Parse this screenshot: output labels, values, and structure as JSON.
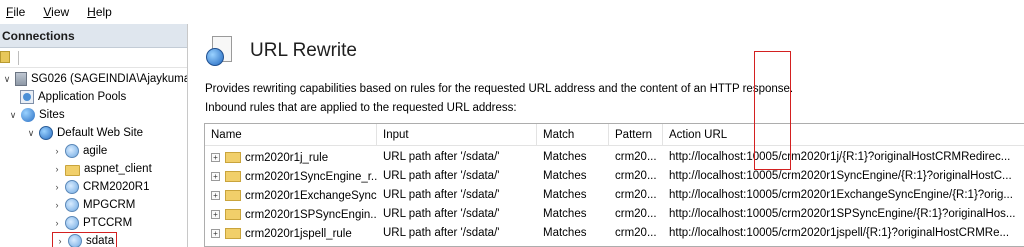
{
  "menu": [
    {
      "label": "File",
      "key": "F",
      "rest": "ile"
    },
    {
      "label": "View",
      "key": "V",
      "rest": "iew"
    },
    {
      "label": "Help",
      "key": "H",
      "rest": "elp"
    }
  ],
  "connections": {
    "title": "Connections",
    "tree": [
      {
        "label": "SG026 (SAGEINDIA\\Ajaykuma",
        "icon": "server-icon",
        "expander": "v"
      },
      {
        "label": "Application Pools",
        "icon": "app-pools-icon",
        "expander": ""
      },
      {
        "label": "Sites",
        "icon": "sites-icon",
        "expander": "v"
      },
      {
        "label": "Default Web Site",
        "icon": "globe-icon",
        "expander": "v"
      },
      {
        "label": "agile",
        "icon": "application-icon",
        "expander": ">"
      },
      {
        "label": "aspnet_client",
        "icon": "folder-icon",
        "expander": ">"
      },
      {
        "label": "CRM2020R1",
        "icon": "application-icon",
        "expander": ">"
      },
      {
        "label": "MPGCRM",
        "icon": "application-icon",
        "expander": ">"
      },
      {
        "label": "PTCCRM",
        "icon": "application-icon",
        "expander": ">"
      },
      {
        "label": "sdata",
        "icon": "application-icon",
        "expander": ">",
        "selected": true
      }
    ]
  },
  "page": {
    "title": "URL Rewrite",
    "description": "Provides rewriting capabilities based on rules for the requested URL address and the content of an HTTP response.",
    "inbound_caption": "Inbound rules that are applied to the requested URL address:"
  },
  "rules_table": {
    "columns": [
      "Name",
      "Input",
      "Match",
      "Pattern",
      "Action URL"
    ],
    "rows": [
      {
        "name": "crm2020r1j_rule",
        "input": "URL path after '/sdata/'",
        "match": "Matches",
        "pattern": "crm20...",
        "action": "http://localhost:10005/crm2020r1j/{R:1}?originalHostCRMRedirec..."
      },
      {
        "name": "crm2020r1SyncEngine_r...",
        "input": "URL path after '/sdata/'",
        "match": "Matches",
        "pattern": "crm20...",
        "action": "http://localhost:10005/crm2020r1SyncEngine/{R:1}?originalHostC..."
      },
      {
        "name": "crm2020r1ExchangeSync...",
        "input": "URL path after '/sdata/'",
        "match": "Matches",
        "pattern": "crm20...",
        "action": "http://localhost:10005/crm2020r1ExchangeSyncEngine/{R:1}?orig..."
      },
      {
        "name": "crm2020r1SPSyncEngin...",
        "input": "URL path after '/sdata/'",
        "match": "Matches",
        "pattern": "crm20...",
        "action": "http://localhost:10005/crm2020r1SPSyncEngine/{R:1}?originalHos..."
      },
      {
        "name": "crm2020r1jspell_rule",
        "input": "URL path after '/sdata/'",
        "match": "Matches",
        "pattern": "crm20...",
        "action": "http://localhost:10005/crm2020r1jspell/{R:1}?originalHostCRMRe..."
      }
    ]
  },
  "colors": {
    "highlight": "#d32020",
    "header_bg": "#dfe6ee"
  }
}
